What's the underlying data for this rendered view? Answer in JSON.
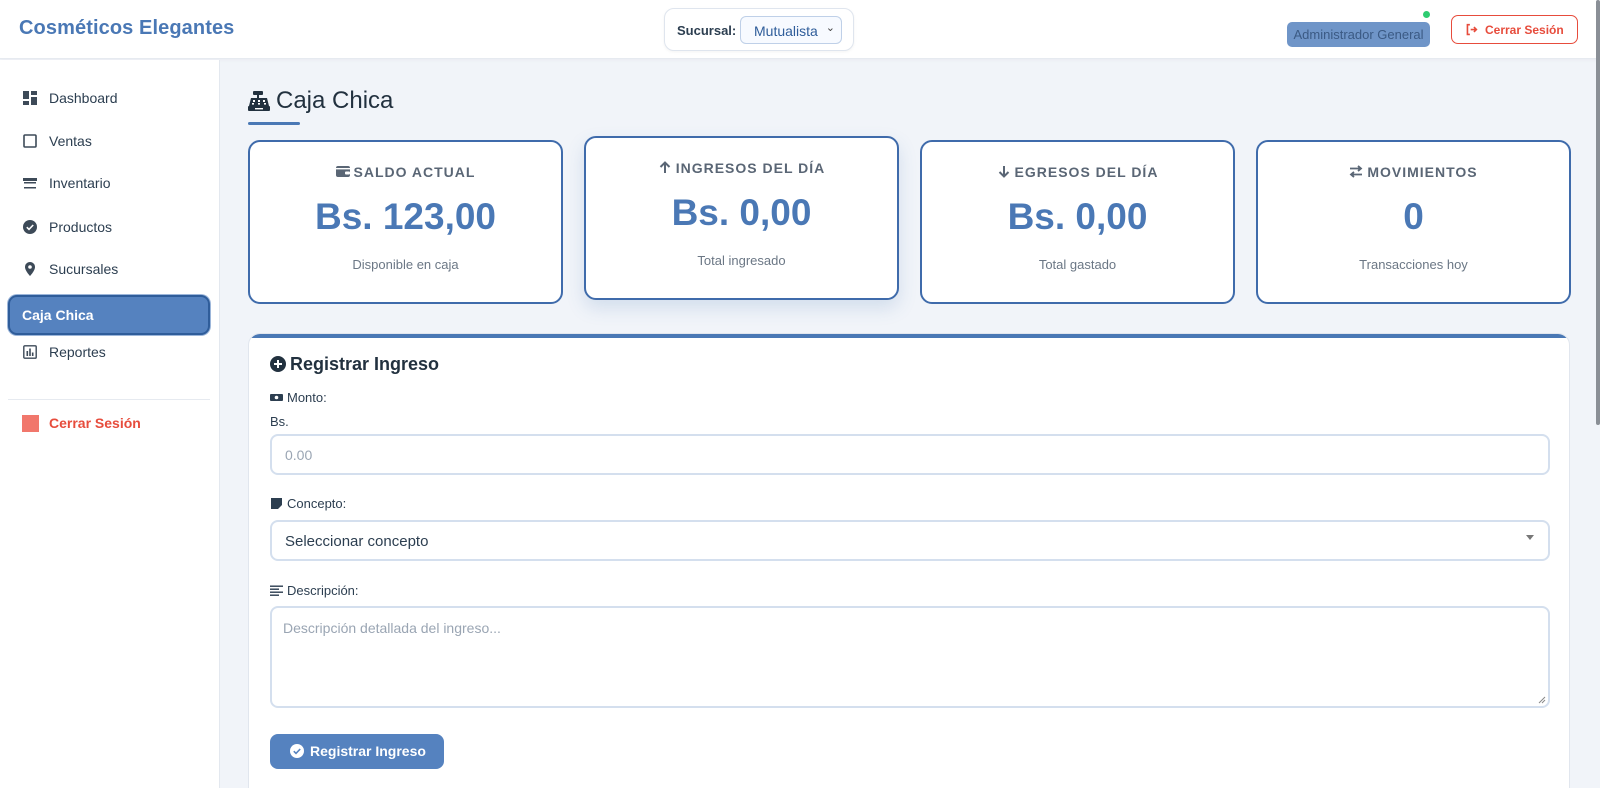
{
  "header": {
    "brand": "Cosméticos Elegantes",
    "branch_label": "Sucursal:",
    "branch_selected": "Mutualista",
    "user_role": "Administrador General",
    "logout_label": "Cerrar Sesión"
  },
  "sidebar": {
    "items": [
      {
        "label": "Dashboard",
        "icon": "dashboard-icon"
      },
      {
        "label": "Ventas",
        "icon": "square-icon"
      },
      {
        "label": "Inventario",
        "icon": "store-icon"
      },
      {
        "label": "Productos",
        "icon": "check-circle-icon"
      },
      {
        "label": "Sucursales",
        "icon": "map-pin-icon"
      },
      {
        "label": "Caja Chica",
        "icon": "",
        "active": true
      },
      {
        "label": "Reportes",
        "icon": "bar-chart-icon"
      }
    ],
    "logout_label": "Cerrar Sesión"
  },
  "page": {
    "title": "Caja Chica"
  },
  "stats": [
    {
      "label": "SALDO ACTUAL",
      "value": "Bs. 123,00",
      "sub": "Disponible en caja",
      "icon": "wallet-icon"
    },
    {
      "label": "INGRESOS DEL DÍA",
      "value": "Bs. 0,00",
      "sub": "Total ingresado",
      "icon": "arrow-up-icon"
    },
    {
      "label": "EGRESOS DEL DÍA",
      "value": "Bs. 0,00",
      "sub": "Total gastado",
      "icon": "arrow-down-icon"
    },
    {
      "label": "MOVIMIENTOS",
      "value": "0",
      "sub": "Transacciones hoy",
      "icon": "exchange-icon"
    }
  ],
  "form": {
    "title": "Registrar Ingreso",
    "amount_label": "Monto:",
    "currency": "Bs.",
    "amount_placeholder": "0.00",
    "concept_label": "Concepto:",
    "concept_selected": "Seleccionar concepto",
    "description_label": "Descripción:",
    "description_placeholder": "Descripción detallada del ingreso...",
    "submit_label": "Registrar Ingreso"
  },
  "colors": {
    "accent": "#4a78b5",
    "danger": "#e74c3c",
    "online": "#2ecc71"
  }
}
